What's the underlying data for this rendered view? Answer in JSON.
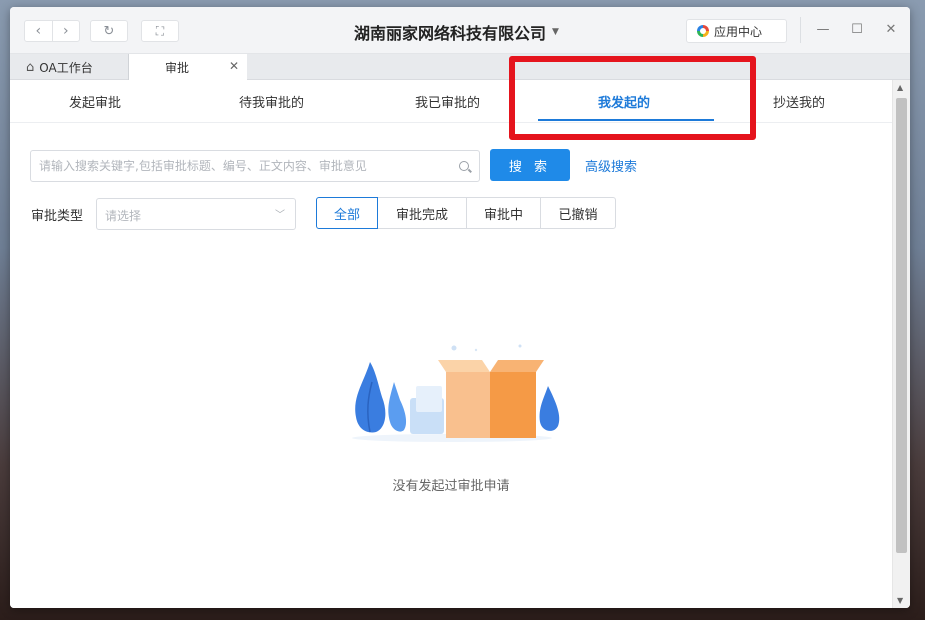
{
  "titlebar": {
    "title": "湖南丽家网络科技有限公司",
    "back_icon": "chevron-left-icon",
    "forward_icon": "chevron-right-icon",
    "refresh_icon": "refresh-icon",
    "expand_icon": "fullscreen-icon",
    "app_center_label": "应用中心",
    "minimize_icon": "minimize-icon",
    "maximize_icon": "maximize-icon",
    "close_icon": "close-icon"
  },
  "tabs": [
    {
      "label": "OA工作台",
      "icon": "home-icon",
      "active": false
    },
    {
      "label": "审批",
      "active": true,
      "closable": true
    }
  ],
  "subtabs": [
    {
      "label": "发起审批"
    },
    {
      "label": "待我审批的"
    },
    {
      "label": "我已审批的"
    },
    {
      "label": "我发起的",
      "active": true
    },
    {
      "label": "抄送我的"
    }
  ],
  "search": {
    "placeholder": "请输入搜索关键字,包括审批标题、编号、正文内容、审批意见",
    "button_label": "搜 索",
    "advanced_label": "高级搜索"
  },
  "filter": {
    "type_label": "审批类型",
    "type_placeholder": "请选择",
    "status_options": [
      {
        "label": "全部",
        "active": true
      },
      {
        "label": "审批完成"
      },
      {
        "label": "审批中"
      },
      {
        "label": "已撤销"
      }
    ]
  },
  "empty_state": {
    "message": "没有发起过审批申请"
  },
  "colors": {
    "accent": "#1d7ad9",
    "primary_button": "#1f8ae8",
    "highlight": "#e5141d",
    "box_orange": "#f7a25c"
  }
}
